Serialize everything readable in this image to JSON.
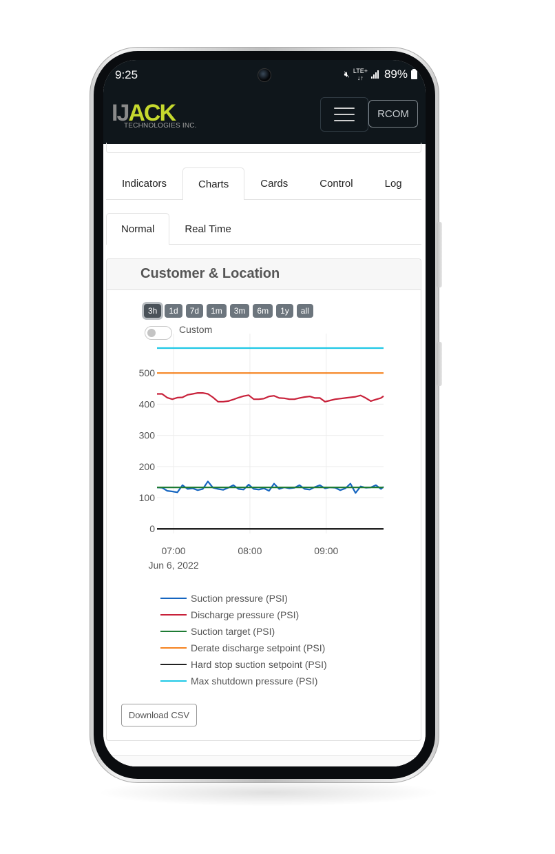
{
  "status_bar": {
    "time": "9:25",
    "mute_icon": "vibrate-mute-icon",
    "network_label": "LTE+",
    "signal_icon": "signal-bars-icon",
    "battery_percent": "89%",
    "battery_icon": "battery-icon"
  },
  "navbar": {
    "logo_main": "ACK",
    "logo_prefix": "IJ",
    "logo_sub": "TECHNOLOGIES INC.",
    "menu_icon": "hamburger-menu-icon",
    "rcom_label": "RCOM"
  },
  "tabs": [
    {
      "label": "Indicators",
      "active": false
    },
    {
      "label": "Charts",
      "active": true
    },
    {
      "label": "Cards",
      "active": false
    },
    {
      "label": "Control",
      "active": false
    },
    {
      "label": "Log",
      "active": false
    }
  ],
  "subtabs": [
    {
      "label": "Normal",
      "active": true
    },
    {
      "label": "Real Time",
      "active": false
    }
  ],
  "card": {
    "title": "Customer & Location",
    "range_buttons": [
      {
        "label": "3h",
        "active": true
      },
      {
        "label": "1d",
        "active": false
      },
      {
        "label": "7d",
        "active": false
      },
      {
        "label": "1m",
        "active": false
      },
      {
        "label": "3m",
        "active": false
      },
      {
        "label": "6m",
        "active": false
      },
      {
        "label": "1y",
        "active": false
      },
      {
        "label": "all",
        "active": false
      }
    ],
    "custom_label": "Custom",
    "custom_enabled": false,
    "download_label": "Download CSV"
  },
  "chart_data": {
    "type": "line",
    "title": "",
    "xlabel": "",
    "ylabel": "",
    "x_range": [
      "06:47",
      "09:45"
    ],
    "x_ticks": [
      {
        "time": "07:00",
        "label": "07:00",
        "sublabel": "Jun 6, 2022"
      },
      {
        "time": "08:00",
        "label": "08:00",
        "sublabel": ""
      },
      {
        "time": "09:00",
        "label": "09:00",
        "sublabel": ""
      }
    ],
    "ylim": [
      -15,
      600
    ],
    "y_ticks": [
      0,
      100,
      200,
      300,
      400,
      500
    ],
    "grid": true,
    "legend_position": "bottom",
    "x_minutes_from_0647": [
      0,
      4,
      8,
      12,
      16,
      20,
      24,
      28,
      32,
      36,
      40,
      44,
      48,
      52,
      56,
      60,
      64,
      68,
      72,
      76,
      80,
      84,
      88,
      92,
      96,
      100,
      104,
      108,
      112,
      116,
      120,
      124,
      128,
      132,
      136,
      140,
      144,
      148,
      152,
      156,
      160,
      164,
      168,
      172,
      176,
      178
    ],
    "series": [
      {
        "name": "Suction pressure (PSI)",
        "color": "#1565c0",
        "values": [
          133,
          132,
          122,
          120,
          117,
          140,
          128,
          130,
          124,
          128,
          152,
          132,
          128,
          125,
          132,
          140,
          128,
          126,
          142,
          128,
          126,
          130,
          122,
          145,
          128,
          133,
          130,
          132,
          140,
          128,
          126,
          134,
          140,
          130,
          133,
          132,
          124,
          130,
          145,
          115,
          136,
          132,
          133,
          140,
          128,
          135
        ]
      },
      {
        "name": "Discharge pressure (PSI)",
        "color": "#c8213a",
        "values": [
          433,
          433,
          421,
          416,
          421,
          422,
          430,
          433,
          436,
          436,
          433,
          422,
          408,
          408,
          410,
          415,
          421,
          426,
          429,
          416,
          416,
          418,
          425,
          427,
          420,
          419,
          416,
          416,
          420,
          423,
          425,
          420,
          420,
          408,
          412,
          416,
          418,
          420,
          422,
          424,
          428,
          420,
          410,
          415,
          420,
          426
        ]
      },
      {
        "name": "Suction target (PSI)",
        "color": "#1e7b34",
        "values": [
          133,
          133,
          133,
          133,
          133,
          133,
          133,
          133,
          133,
          133,
          133,
          133,
          133,
          133,
          133,
          133,
          133,
          133,
          133,
          133,
          133,
          133,
          133,
          133,
          133,
          133,
          133,
          133,
          133,
          133,
          133,
          133,
          133,
          133,
          133,
          133,
          133,
          133,
          133,
          133,
          133,
          133,
          133,
          133,
          133,
          133
        ]
      },
      {
        "name": "Derate discharge setpoint (PSI)",
        "color": "#f5821f",
        "values": [
          500,
          500,
          500,
          500,
          500,
          500,
          500,
          500,
          500,
          500,
          500,
          500,
          500,
          500,
          500,
          500,
          500,
          500,
          500,
          500,
          500,
          500,
          500,
          500,
          500,
          500,
          500,
          500,
          500,
          500,
          500,
          500,
          500,
          500,
          500,
          500,
          500,
          500,
          500,
          500,
          500,
          500,
          500,
          500,
          500,
          500
        ]
      },
      {
        "name": "Hard stop suction setpoint (PSI)",
        "color": "#222222",
        "values": [
          0,
          0,
          0,
          0,
          0,
          0,
          0,
          0,
          0,
          0,
          0,
          0,
          0,
          0,
          0,
          0,
          0,
          0,
          0,
          0,
          0,
          0,
          0,
          0,
          0,
          0,
          0,
          0,
          0,
          0,
          0,
          0,
          0,
          0,
          0,
          0,
          0,
          0,
          0,
          0,
          0,
          0,
          0,
          0,
          0,
          0
        ]
      },
      {
        "name": "Max shutdown pressure (PSI)",
        "color": "#1ec8e6",
        "values": [
          580,
          580,
          580,
          580,
          580,
          580,
          580,
          580,
          580,
          580,
          580,
          580,
          580,
          580,
          580,
          580,
          580,
          580,
          580,
          580,
          580,
          580,
          580,
          580,
          580,
          580,
          580,
          580,
          580,
          580,
          580,
          580,
          580,
          580,
          580,
          580,
          580,
          580,
          580,
          580,
          580,
          580,
          580,
          580,
          580,
          580
        ]
      }
    ]
  }
}
